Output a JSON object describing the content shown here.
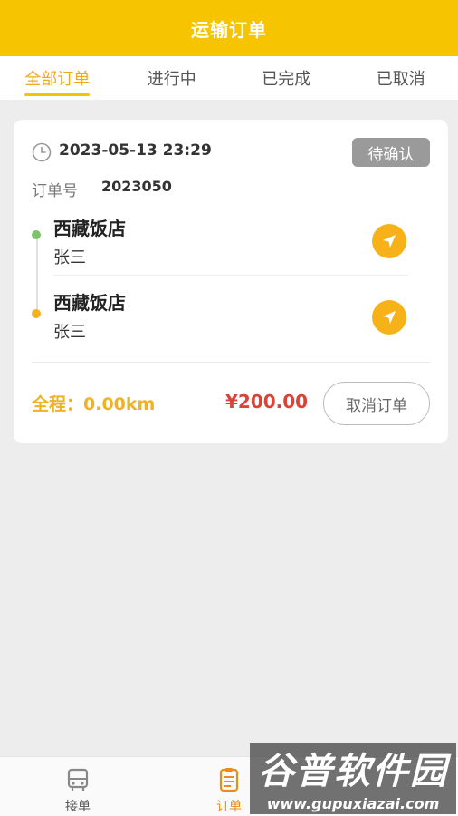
{
  "header": {
    "title": "运输订单"
  },
  "tabs": [
    {
      "label": "全部订单",
      "active": true
    },
    {
      "label": "进行中",
      "active": false
    },
    {
      "label": "已完成",
      "active": false
    },
    {
      "label": "已取消",
      "active": false
    }
  ],
  "order": {
    "time": "2023-05-13 23:29",
    "status": "待确认",
    "order_no_label": "订单号",
    "order_no": "2023050",
    "stops": [
      {
        "place": "西藏饭店",
        "person": "张三",
        "dot": "start",
        "icon": "navigate-icon"
      },
      {
        "place": "西藏饭店",
        "person": "张三",
        "dot": "end",
        "icon": "navigate-icon"
      }
    ],
    "distance": "全程：0.00km",
    "price": "¥200.00",
    "cancel_label": "取消订单"
  },
  "bottom_nav": [
    {
      "label": "接单",
      "icon": "bus-icon",
      "active": false
    },
    {
      "label": "订单",
      "icon": "order-list-icon",
      "active": true
    }
  ],
  "watermark": {
    "main": "谷普软件园",
    "sub": "www.gupuxiazai.com"
  },
  "colors": {
    "brand": "#f6c400",
    "accent": "#f0a81c",
    "price": "#d7443a",
    "start_dot": "#7cc36b",
    "end_dot": "#f6b21b"
  }
}
